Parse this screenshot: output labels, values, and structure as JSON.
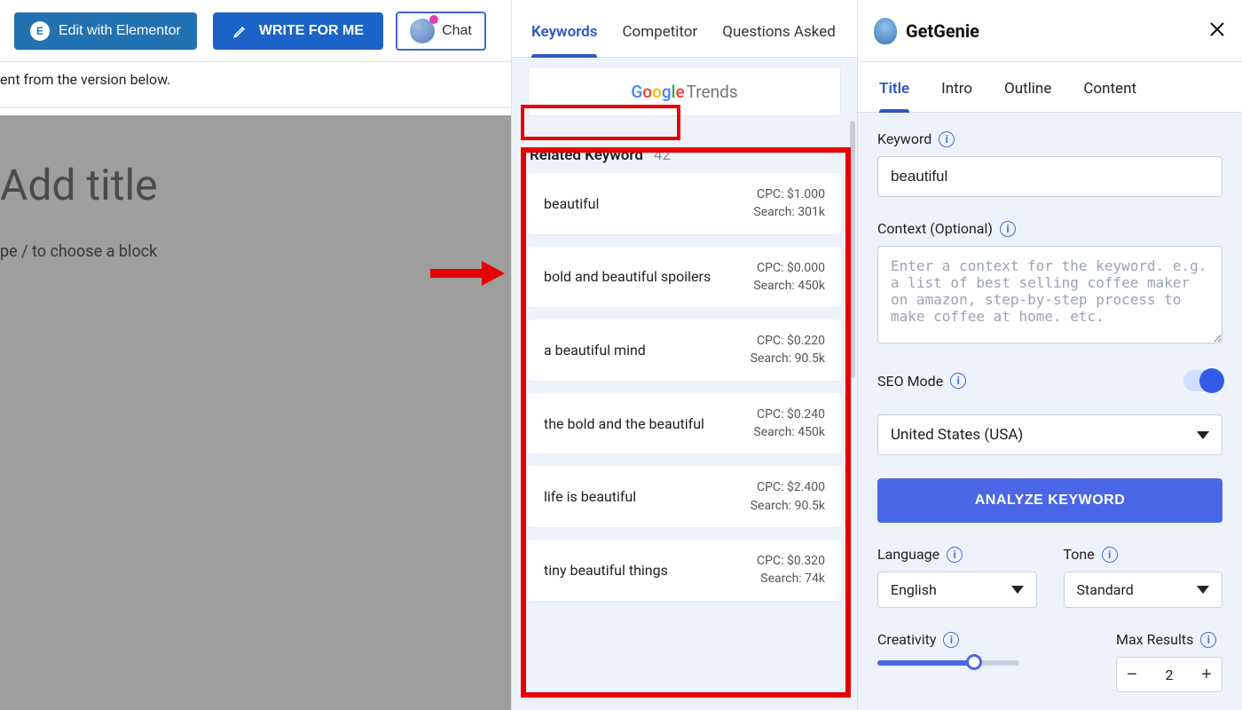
{
  "toolbar": {
    "elementor_label": "Edit with Elementor",
    "write_label": "WRITE FOR ME",
    "chat_label": "Chat"
  },
  "editor": {
    "notice": "ent from the version below.",
    "title_placeholder": "Add title",
    "block_hint": "pe / to choose a block"
  },
  "mid": {
    "tabs": [
      "Keywords",
      "Competitor",
      "Questions Asked"
    ],
    "active_tab": 0,
    "gtrends_label": "Trends",
    "related_label": "Related Keyword",
    "related_count": "42",
    "keywords": [
      {
        "kw": "beautiful",
        "cpc": "CPC: $1.000",
        "search": "Search: 301k"
      },
      {
        "kw": "bold and beautiful spoilers",
        "cpc": "CPC: $0.000",
        "search": "Search: 450k"
      },
      {
        "kw": "a beautiful mind",
        "cpc": "CPC: $0.220",
        "search": "Search: 90.5k"
      },
      {
        "kw": "the bold and the beautiful",
        "cpc": "CPC: $0.240",
        "search": "Search: 450k"
      },
      {
        "kw": "life is beautiful",
        "cpc": "CPC: $2.400",
        "search": "Search: 90.5k"
      },
      {
        "kw": "tiny beautiful things",
        "cpc": "CPC: $0.320",
        "search": "Search: 74k"
      }
    ]
  },
  "right": {
    "brand": "GetGenie",
    "tabs": [
      "Title",
      "Intro",
      "Outline",
      "Content"
    ],
    "active_tab": 0,
    "keyword_label": "Keyword",
    "keyword_value": "beautiful",
    "context_label": "Context (Optional)",
    "context_placeholder": "Enter a context for the keyword. e.g. a list of best selling coffee maker on amazon, step-by-step process to make coffee at home. etc.",
    "seo_label": "SEO Mode",
    "country_value": "United States (USA)",
    "analyze_label": "ANALYZE KEYWORD",
    "language_label": "Language",
    "language_value": "English",
    "tone_label": "Tone",
    "tone_value": "Standard",
    "creativity_label": "Creativity",
    "maxresults_label": "Max Results",
    "maxresults_value": "2"
  }
}
